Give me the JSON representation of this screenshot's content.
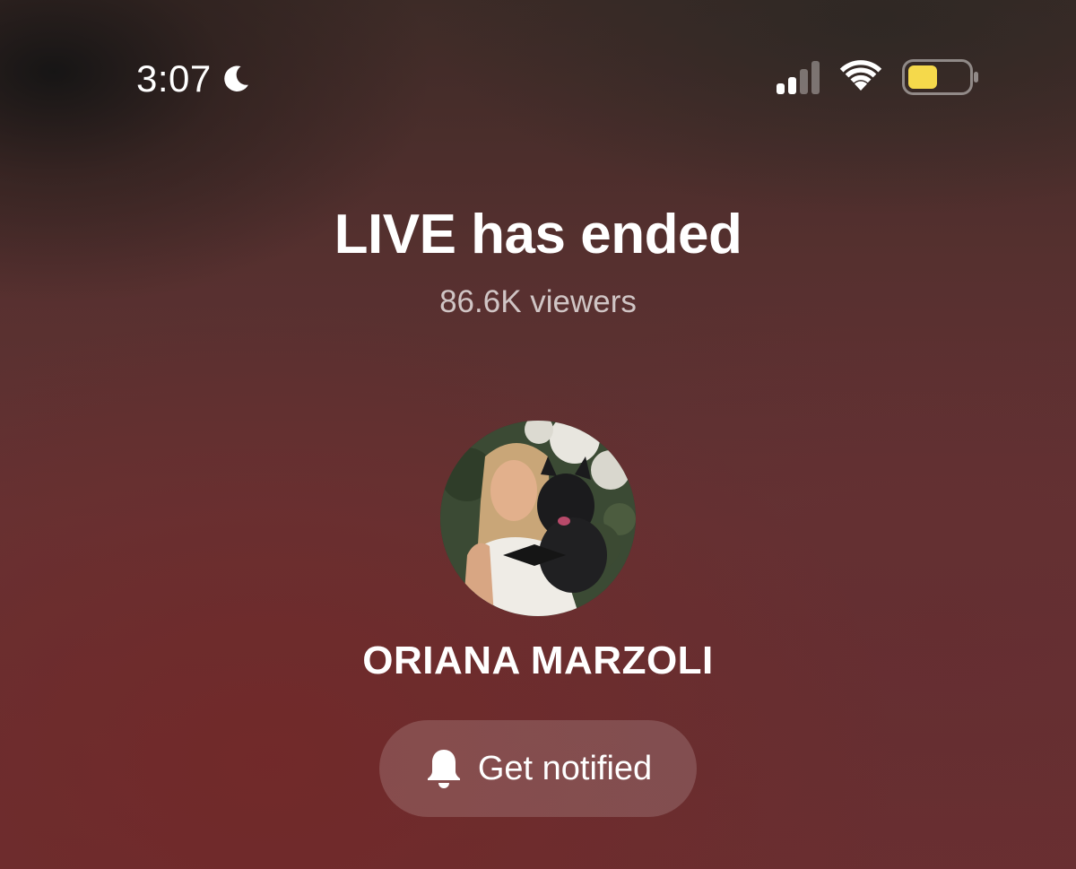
{
  "status_bar": {
    "time": "3:07",
    "focus_icon": "moon-icon",
    "signal_icon": "cellular-signal-icon",
    "wifi_icon": "wifi-icon",
    "battery_icon": "battery-icon",
    "battery_color": "#f5d94b"
  },
  "live": {
    "title": "LIVE has ended",
    "viewers": "86.6K viewers"
  },
  "host": {
    "name": "ORIANA MARZOLI",
    "avatar_icon": "profile-photo"
  },
  "actions": {
    "notify_label": "Get notified",
    "notify_icon": "bell-icon"
  },
  "colors": {
    "background": "#5a2d2f",
    "text": "#ffffff"
  }
}
